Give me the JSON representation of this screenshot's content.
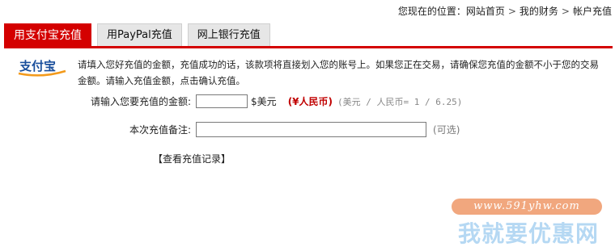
{
  "breadcrumb": {
    "prefix": "您现在的位置：",
    "items": [
      "网站首页",
      "我的财务",
      "帐户充值"
    ],
    "separator": ">"
  },
  "tabs": [
    {
      "label": "用支付宝充值",
      "active": true
    },
    {
      "label": "用PayPal充值",
      "active": false
    },
    {
      "label": "网上银行充值",
      "active": false
    }
  ],
  "logo": {
    "text": "支付宝"
  },
  "intro": {
    "text": "请填入您好充值的金额，充值成功的话，该款项将直接划入您的账号上。如果您正在交易，请确保您充值的金额不小于您的交易金额。请输入充值金额，点击确认充值。"
  },
  "form": {
    "amount_label": "请输入您要充值的金额:",
    "amount_value": "",
    "amount_unit": "$美元",
    "rmb_text": "(¥人民币)",
    "rate_text": "(美元 / 人民币= 1 / 6.25)",
    "remark_label": "本次充值备注:",
    "remark_value": "",
    "optional_text": "(可选)"
  },
  "history_link": "【查看充值记录】",
  "watermark": {
    "url": "www.591yhw.com",
    "name": "我就要优惠网"
  },
  "colors": {
    "accent": "#d40000",
    "rmb": "#c00000",
    "tab_inactive": "#e6e6e6",
    "watermark_url_bg": "#f1a77e",
    "watermark_name": "#b5d8f3"
  }
}
